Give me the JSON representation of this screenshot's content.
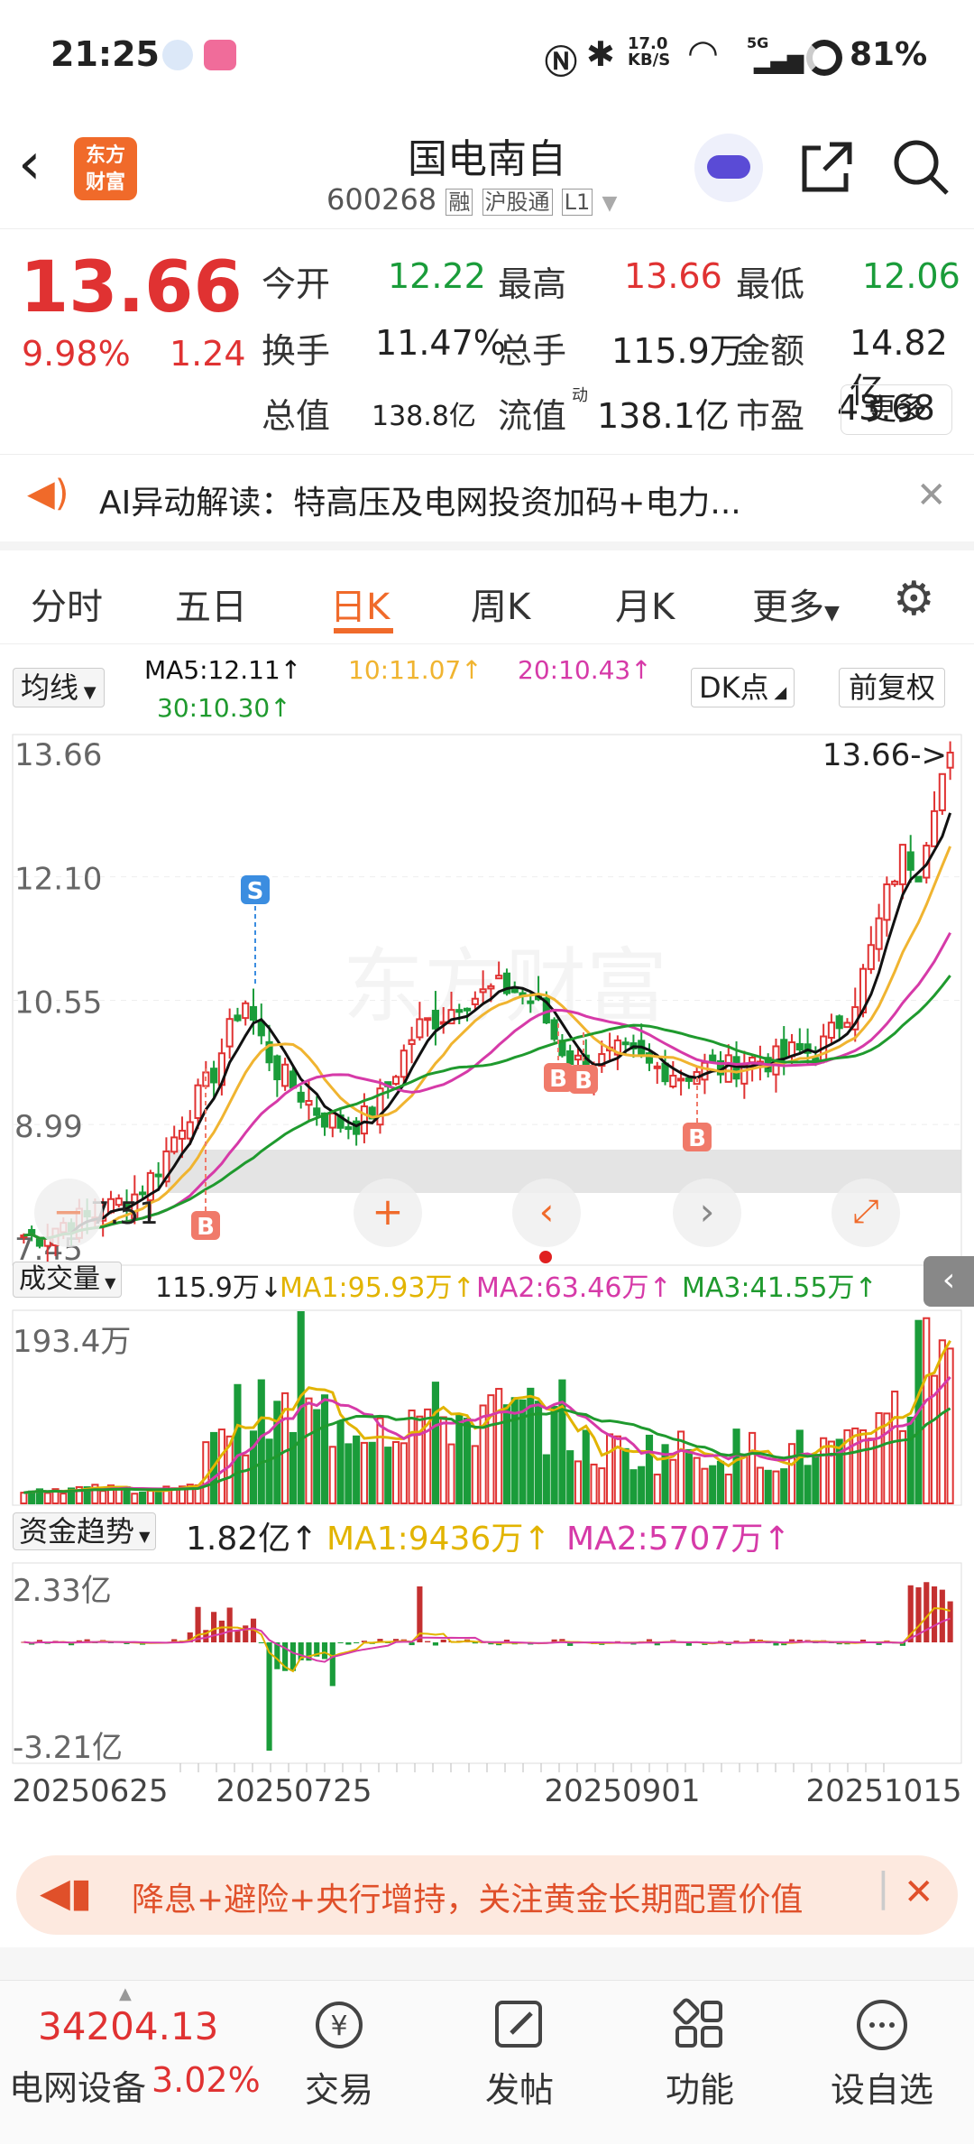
{
  "status": {
    "time": "21:25",
    "net_speed": "17.0\nKB/S",
    "battery": "81%",
    "signal": "5G"
  },
  "header": {
    "logo": "东方\n财富",
    "title": "国电南自",
    "code": "600268",
    "tags": [
      "融",
      "沪股通",
      "L1"
    ]
  },
  "quote": {
    "price": "13.66",
    "pct": "9.98%",
    "change": "1.24",
    "fields": [
      {
        "label": "今开",
        "value": "12.22",
        "color": "#1a9c3a"
      },
      {
        "label": "最高",
        "value": "13.66",
        "color": "#e03232"
      },
      {
        "label": "最低",
        "value": "12.06",
        "color": "#1a9c3a"
      },
      {
        "label": "换手",
        "value": "11.47%",
        "color": "#222"
      },
      {
        "label": "总手",
        "value": "115.9万",
        "color": "#222"
      },
      {
        "label": "金额",
        "value": "14.82亿",
        "color": "#222"
      },
      {
        "label": "总值",
        "value": "138.8亿",
        "color": "#222"
      },
      {
        "label": "流值",
        "value": "138.1亿",
        "color": "#222"
      },
      {
        "label": "市盈",
        "value": "43.68",
        "color": "#222"
      }
    ],
    "pe_sup": "动",
    "more": "更多"
  },
  "banner": {
    "text": "AI异动解读：特高压及电网投资加码+电力..."
  },
  "tabs": [
    "分时",
    "五日",
    "日K",
    "周K",
    "月K",
    "更多"
  ],
  "active_tab": "日K",
  "ma_bar": {
    "selector": "均线",
    "ma5": "MA5:12.11↑",
    "ma10": "10:11.07↑",
    "ma20": "20:10.43↑",
    "ma30": "30:10.30↑",
    "dk": "DK点",
    "fq": "前复权"
  },
  "price_axis": [
    "13.66",
    "12.10",
    "10.55",
    "8.99",
    "7.45"
  ],
  "last_label": "13.66->",
  "low_label": "7.51",
  "volume_bar": {
    "selector": "成交量",
    "val": "115.9万↓",
    "ma1": "MA1:95.93万↑",
    "ma2": "MA2:63.46万↑",
    "ma3": "MA3:41.55万↑",
    "max": "193.4万"
  },
  "fund_bar": {
    "selector": "资金趋势",
    "val": "1.82亿↑",
    "ma1": "MA1:9436万↑",
    "ma2": "MA2:5707万↑",
    "max": "2.33亿",
    "min": "-3.21亿"
  },
  "dates": [
    "20250625",
    "20250725",
    "20250901",
    "20251015"
  ],
  "signals": {
    "s": "S",
    "b": "B"
  },
  "watermark": "东方财富",
  "promo": {
    "text": "降息+避险+央行增持，关注黄金长期配置价值"
  },
  "bottom": {
    "index_value": "34204.13",
    "index_name": "电网设备",
    "index_pct": "3.02%",
    "nav": [
      {
        "label": "交易",
        "icon": "trade-icon"
      },
      {
        "label": "发帖",
        "icon": "post-icon"
      },
      {
        "label": "功能",
        "icon": "function-icon"
      },
      {
        "label": "设自选",
        "icon": "add-watchlist-icon"
      }
    ]
  },
  "colors": {
    "up": "#e03232",
    "down": "#1a9c3a",
    "ma5": "#111111",
    "ma10": "#f0b430",
    "ma20": "#d63aa8",
    "ma30": "#1f9a2e",
    "accent": "#f06a2a"
  }
}
